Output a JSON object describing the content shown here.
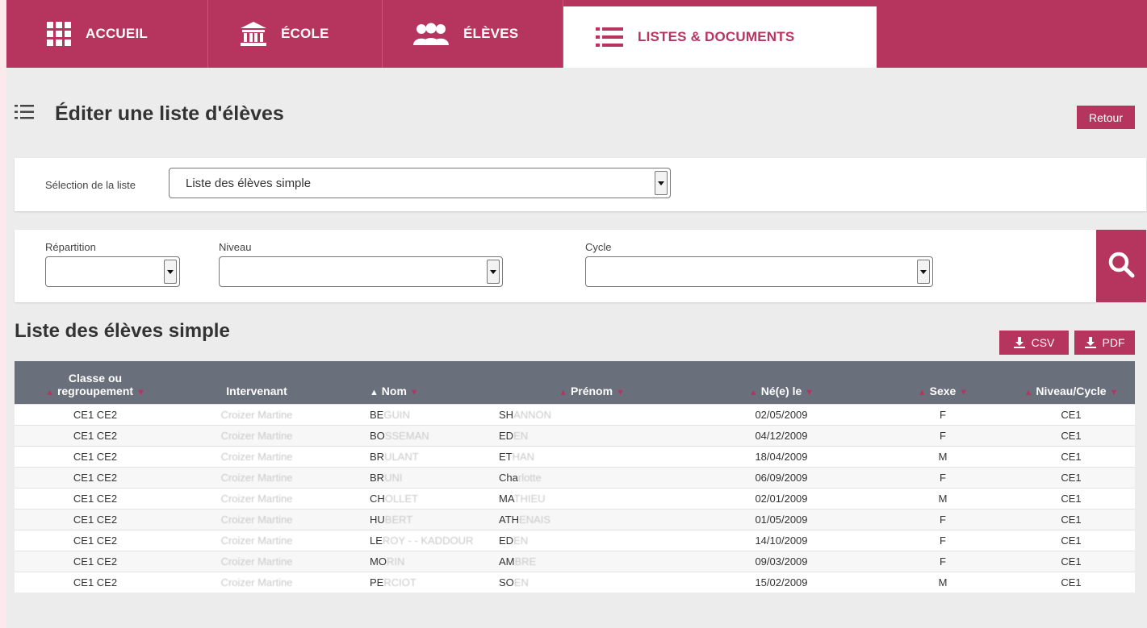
{
  "nav": {
    "items": [
      {
        "label": "ACCUEIL",
        "icon": "grid-icon"
      },
      {
        "label": "ÉCOLE",
        "icon": "school-building-icon"
      },
      {
        "label": "ÉLÈVES",
        "icon": "students-icon"
      },
      {
        "label": "LISTES & DOCUMENTS",
        "icon": "list-icon",
        "active": true
      }
    ]
  },
  "page": {
    "title": "Éditer une liste d'élèves",
    "back_label": "Retour"
  },
  "selection": {
    "label": "Sélection de la liste",
    "value": "Liste des élèves simple"
  },
  "filters": {
    "repartition_label": "Répartition",
    "niveau_label": "Niveau",
    "cycle_label": "Cycle",
    "repartition_value": "",
    "niveau_value": "",
    "cycle_value": ""
  },
  "list": {
    "title": "Liste des élèves simple",
    "csv_label": "CSV",
    "pdf_label": "PDF"
  },
  "table": {
    "headers": {
      "classe_1": "Classe ou",
      "classe_2": "regroupement",
      "intervenant": "Intervenant",
      "nom": "Nom",
      "prenom": "Prénom",
      "ne_le": "Né(e) le",
      "sexe": "Sexe",
      "niveau": "Niveau/Cycle"
    },
    "rows": [
      {
        "classe": "CE1 CE2",
        "intervenant": "Croizer Martine",
        "nom_a": "BE",
        "nom_b": "GUIN",
        "prenom_a": "SH",
        "prenom_b": "ANNON",
        "date": "02/05/2009",
        "sexe": "F",
        "niveau": "CE1"
      },
      {
        "classe": "CE1 CE2",
        "intervenant": "Croizer Martine",
        "nom_a": "BO",
        "nom_b": "SSEMAN",
        "prenom_a": "ED",
        "prenom_b": "EN",
        "date": "04/12/2009",
        "sexe": "F",
        "niveau": "CE1"
      },
      {
        "classe": "CE1 CE2",
        "intervenant": "Croizer Martine",
        "nom_a": "BR",
        "nom_b": "ULANT",
        "prenom_a": "ET",
        "prenom_b": "HAN",
        "date": "18/04/2009",
        "sexe": "M",
        "niveau": "CE1"
      },
      {
        "classe": "CE1 CE2",
        "intervenant": "Croizer Martine",
        "nom_a": "BR",
        "nom_b": "UNI",
        "prenom_a": "Cha",
        "prenom_b": "rlotte",
        "date": "06/09/2009",
        "sexe": "F",
        "niveau": "CE1"
      },
      {
        "classe": "CE1 CE2",
        "intervenant": "Croizer Martine",
        "nom_a": "CH",
        "nom_b": "OLLET",
        "prenom_a": "MA",
        "prenom_b": "THIEU",
        "date": "02/01/2009",
        "sexe": "M",
        "niveau": "CE1"
      },
      {
        "classe": "CE1 CE2",
        "intervenant": "Croizer Martine",
        "nom_a": "HU",
        "nom_b": "BERT",
        "prenom_a": "ATH",
        "prenom_b": "ENAIS",
        "date": "01/05/2009",
        "sexe": "F",
        "niveau": "CE1"
      },
      {
        "classe": "CE1 CE2",
        "intervenant": "Croizer Martine",
        "nom_a": "LE",
        "nom_b": "ROY - - KADDOUR",
        "prenom_a": "ED",
        "prenom_b": "EN",
        "date": "14/10/2009",
        "sexe": "F",
        "niveau": "CE1"
      },
      {
        "classe": "CE1 CE2",
        "intervenant": "Croizer Martine",
        "nom_a": "MO",
        "nom_b": "RIN",
        "prenom_a": "AM",
        "prenom_b": "BRE",
        "date": "09/03/2009",
        "sexe": "F",
        "niveau": "CE1"
      },
      {
        "classe": "CE1 CE2",
        "intervenant": "Croizer Martine",
        "nom_a": "PE",
        "nom_b": "RCIOT",
        "prenom_a": "SO",
        "prenom_b": "EN",
        "date": "15/02/2009",
        "sexe": "M",
        "niveau": "CE1"
      }
    ]
  },
  "colors": {
    "brand": "#b5355f",
    "header_bg": "#6a6f7c",
    "page_bg": "#ececec"
  }
}
